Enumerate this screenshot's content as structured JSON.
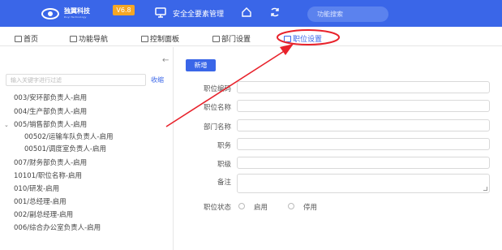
{
  "header": {
    "logo_name": "独翼科技",
    "logo_sub": "Duyi Technology",
    "version": "V6.8",
    "system_title": "安全全要素管理",
    "search_placeholder": "功能搜索"
  },
  "tabs": [
    {
      "label": "首页",
      "active": false
    },
    {
      "label": "功能导航",
      "active": false
    },
    {
      "label": "控制面板",
      "active": false
    },
    {
      "label": "部门设置",
      "active": false
    },
    {
      "label": "职位设置",
      "active": true
    }
  ],
  "sidebar": {
    "filter_placeholder": "输入关键字进行过滤",
    "collapse_label": "收缩",
    "tree": [
      {
        "label": "003/安环部负责人-启用",
        "level": 0
      },
      {
        "label": "004/生产部负责人-启用",
        "level": 0
      },
      {
        "label": "005/销售部负责人-启用",
        "level": 0,
        "expanded": true
      },
      {
        "label": "00502/运输车队负责人-启用",
        "level": 1
      },
      {
        "label": "00501/调度室负责人-启用",
        "level": 1
      },
      {
        "label": "007/财务部负责人-启用",
        "level": 0
      },
      {
        "label": "10101/职位名称-启用",
        "level": 0
      },
      {
        "label": "010/研发-启用",
        "level": 0
      },
      {
        "label": "001/总经理-启用",
        "level": 0
      },
      {
        "label": "002/副总经理-启用",
        "level": 0
      },
      {
        "label": "006/综合办公室负责人-启用",
        "level": 0
      }
    ]
  },
  "form": {
    "add_button": "新增",
    "fields": [
      {
        "label": "职位编码",
        "value": ""
      },
      {
        "label": "职位名称",
        "value": ""
      },
      {
        "label": "部门名称",
        "value": ""
      },
      {
        "label": "职务",
        "value": ""
      },
      {
        "label": "职级",
        "value": ""
      },
      {
        "label": "备注",
        "value": ""
      }
    ],
    "status_label": "职位状态",
    "status_options": [
      "启用",
      "停用"
    ]
  },
  "colors": {
    "header_bg": "#3a66e8",
    "version_badge": "#f5a623",
    "accent": "#3a66e8",
    "annotation": "#e8222b"
  }
}
